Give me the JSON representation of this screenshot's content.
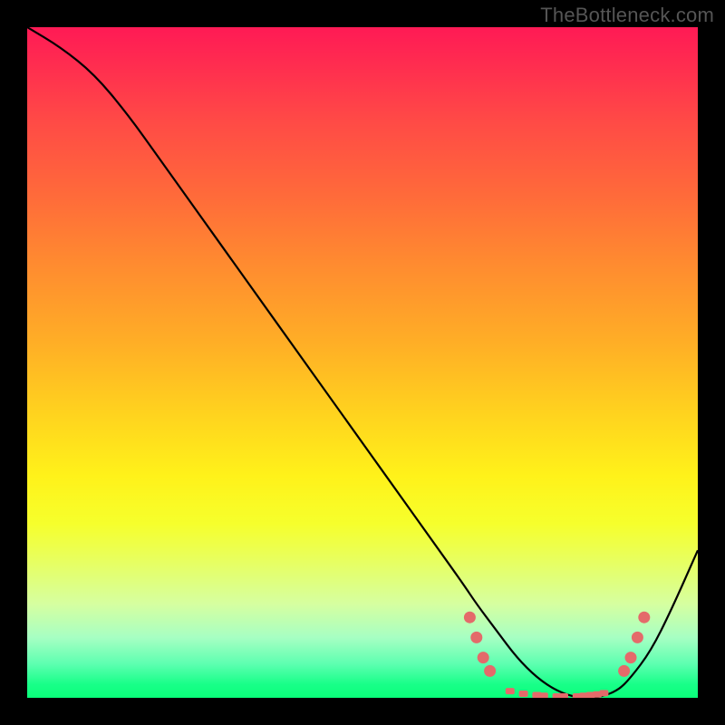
{
  "watermark": "TheBottleneck.com",
  "colors": {
    "coral": "#e46a6a",
    "curve": "#000000",
    "background_black": "#000000"
  },
  "chart_data": {
    "type": "line",
    "title": "",
    "xlabel": "",
    "ylabel": "",
    "xlim": [
      0,
      100
    ],
    "ylim": [
      0,
      100
    ],
    "grid": false,
    "legend": false,
    "series": [
      {
        "name": "bottleneck-curve",
        "x": [
          0,
          5,
          10,
          15,
          20,
          25,
          30,
          35,
          40,
          45,
          50,
          55,
          60,
          65,
          67,
          70,
          73,
          76,
          79,
          82,
          85,
          88,
          90,
          93,
          96,
          100
        ],
        "y": [
          100,
          97,
          93,
          87,
          80,
          73,
          66,
          59,
          52,
          45,
          38,
          31,
          24,
          17,
          14,
          10,
          6,
          3,
          1,
          0,
          0,
          1,
          3,
          7,
          13,
          22
        ]
      }
    ],
    "markers": [
      {
        "shape": "circle",
        "x": 66,
        "y": 12
      },
      {
        "shape": "circle",
        "x": 67,
        "y": 9
      },
      {
        "shape": "circle",
        "x": 68,
        "y": 6
      },
      {
        "shape": "circle",
        "x": 69,
        "y": 4
      },
      {
        "shape": "circle",
        "x": 89,
        "y": 4
      },
      {
        "shape": "circle",
        "x": 90,
        "y": 6
      },
      {
        "shape": "circle",
        "x": 91,
        "y": 9
      },
      {
        "shape": "circle",
        "x": 92,
        "y": 12
      },
      {
        "shape": "dash",
        "x": 72,
        "y": 1
      },
      {
        "shape": "dash",
        "x": 74,
        "y": 0.6
      },
      {
        "shape": "dash",
        "x": 76,
        "y": 0.4
      },
      {
        "shape": "dash",
        "x": 77,
        "y": 0.3
      },
      {
        "shape": "dash",
        "x": 79,
        "y": 0.2
      },
      {
        "shape": "dash",
        "x": 80,
        "y": 0.2
      },
      {
        "shape": "dash",
        "x": 82,
        "y": 0.2
      },
      {
        "shape": "dash",
        "x": 83,
        "y": 0.3
      },
      {
        "shape": "dash",
        "x": 84,
        "y": 0.4
      },
      {
        "shape": "dash",
        "x": 85,
        "y": 0.5
      },
      {
        "shape": "dash",
        "x": 86,
        "y": 0.7
      }
    ]
  }
}
